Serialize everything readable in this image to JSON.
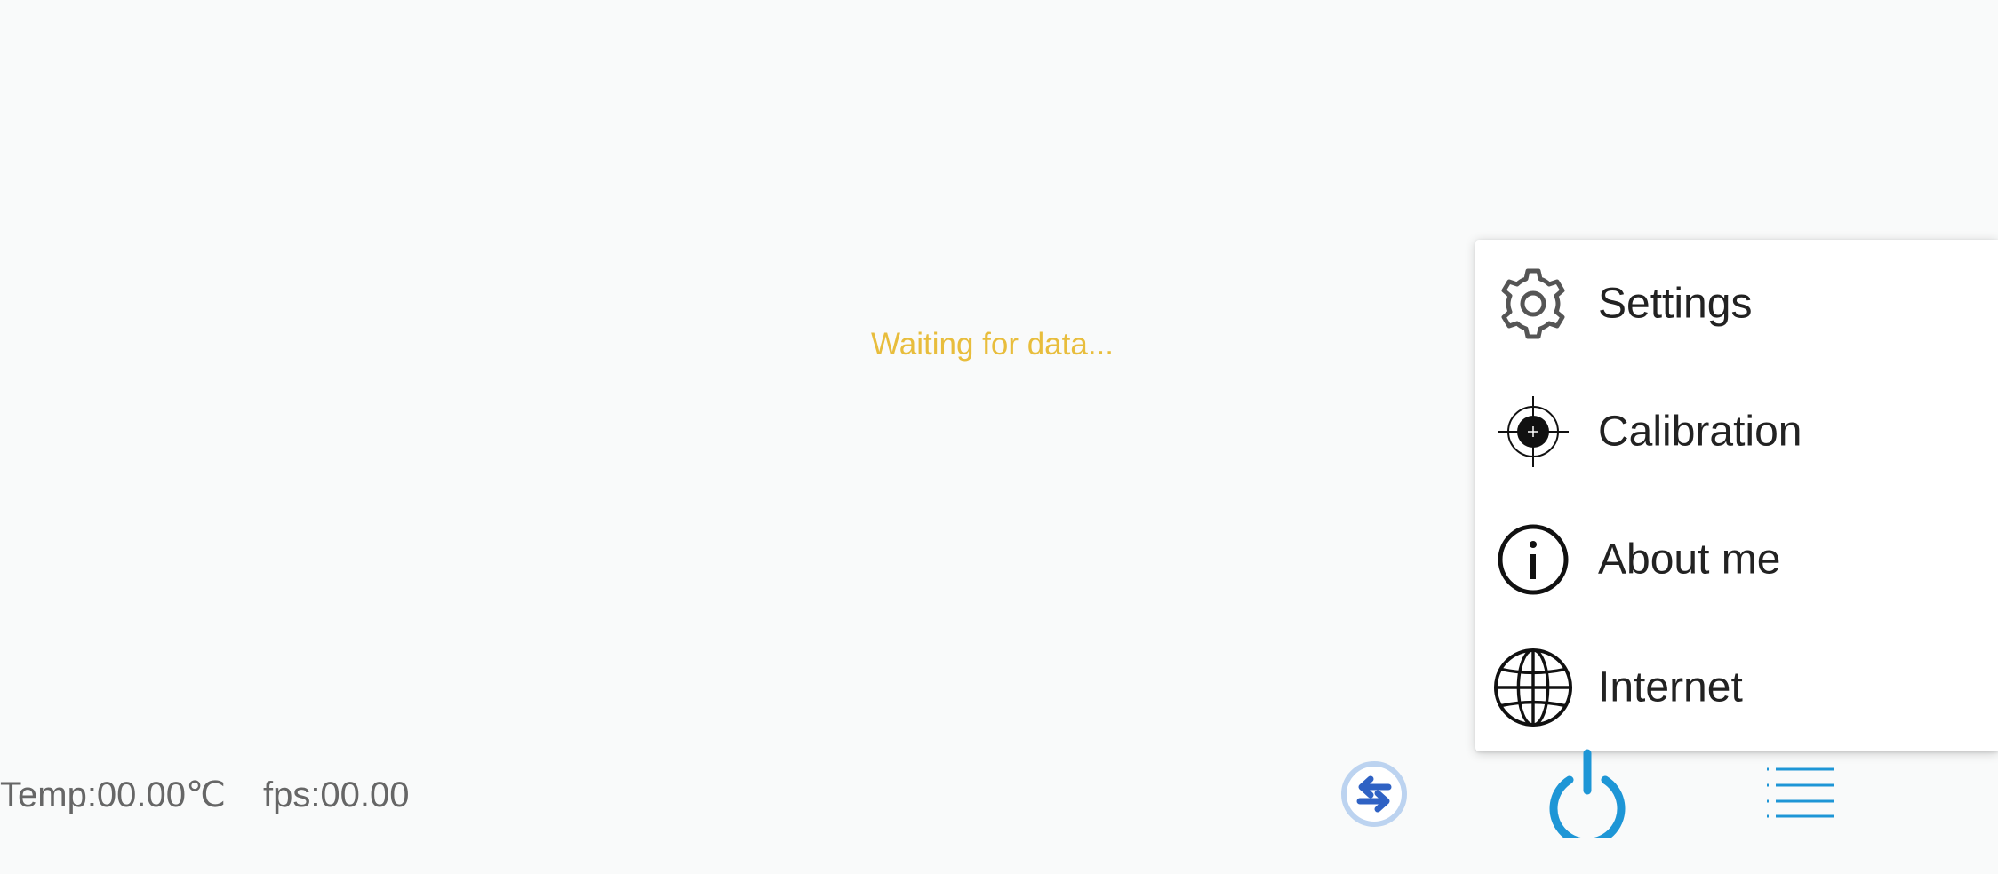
{
  "status": {
    "message": "Waiting for data..."
  },
  "stats": {
    "temp": "Temp:00.00℃",
    "fps": "fps:00.00"
  },
  "menu": {
    "items": [
      {
        "label": "Settings",
        "icon": "gear-icon"
      },
      {
        "label": "Calibration",
        "icon": "crosshair-icon"
      },
      {
        "label": "About me",
        "icon": "info-icon"
      },
      {
        "label": "Internet",
        "icon": "globe-icon"
      }
    ]
  },
  "toolbar": {
    "icons": [
      "swap-arrows-icon",
      "power-icon",
      "list-menu-icon"
    ]
  },
  "colors": {
    "accent": "#1e96d6",
    "status_text": "#e8bd3c",
    "swap_ring": "#bcd3f0",
    "swap_arrows": "#2f62c4"
  }
}
